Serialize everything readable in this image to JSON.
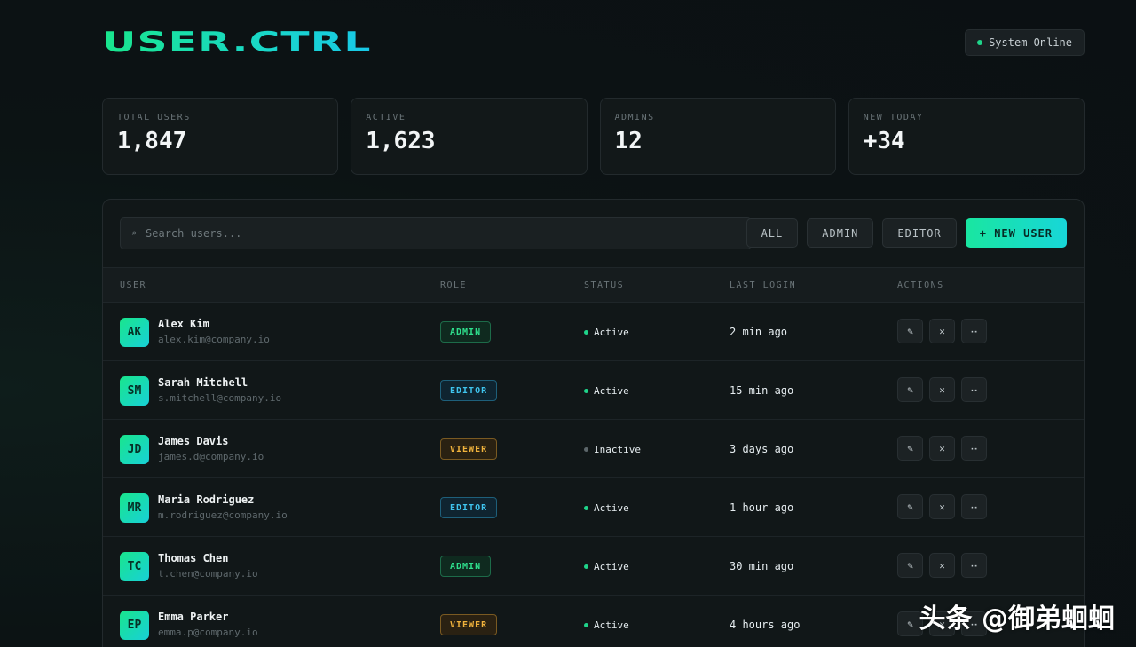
{
  "header": {
    "logo": "USER.CTRL",
    "status_label": "System Online"
  },
  "stats": [
    {
      "label": "TOTAL USERS",
      "value": "1,847"
    },
    {
      "label": "ACTIVE",
      "value": "1,623"
    },
    {
      "label": "ADMINS",
      "value": "12"
    },
    {
      "label": "NEW TODAY",
      "value": "+34"
    }
  ],
  "toolbar": {
    "search_icon": "⌕",
    "search_placeholder": "Search users...",
    "filters": [
      "ALL",
      "ADMIN",
      "EDITOR"
    ],
    "new_user_label": "+ NEW USER"
  },
  "table": {
    "columns": [
      "USER",
      "ROLE",
      "STATUS",
      "LAST LOGIN",
      "ACTIONS"
    ],
    "rows": [
      {
        "initials": "AK",
        "name": "Alex Kim",
        "email": "alex.kim@company.io",
        "role": "ADMIN",
        "status": "Active",
        "last_login": "2 min ago"
      },
      {
        "initials": "SM",
        "name": "Sarah Mitchell",
        "email": "s.mitchell@company.io",
        "role": "EDITOR",
        "status": "Active",
        "last_login": "15 min ago"
      },
      {
        "initials": "JD",
        "name": "James Davis",
        "email": "james.d@company.io",
        "role": "VIEWER",
        "status": "Inactive",
        "last_login": "3 days ago"
      },
      {
        "initials": "MR",
        "name": "Maria Rodriguez",
        "email": "m.rodriguez@company.io",
        "role": "EDITOR",
        "status": "Active",
        "last_login": "1 hour ago"
      },
      {
        "initials": "TC",
        "name": "Thomas Chen",
        "email": "t.chen@company.io",
        "role": "ADMIN",
        "status": "Active",
        "last_login": "30 min ago"
      },
      {
        "initials": "EP",
        "name": "Emma Parker",
        "email": "emma.p@company.io",
        "role": "VIEWER",
        "status": "Active",
        "last_login": "4 hours ago"
      }
    ],
    "action_icons": {
      "edit": "✎",
      "delete": "✕",
      "more": "⋯"
    }
  },
  "watermark": "头条 @御弟蛔蛔",
  "colors": {
    "accent": "#19e68c",
    "accent_2": "#18d0d8",
    "active": "#1fd48a",
    "admin": "#2fe08d",
    "editor": "#3fc4ee",
    "viewer": "#f0b23c"
  }
}
